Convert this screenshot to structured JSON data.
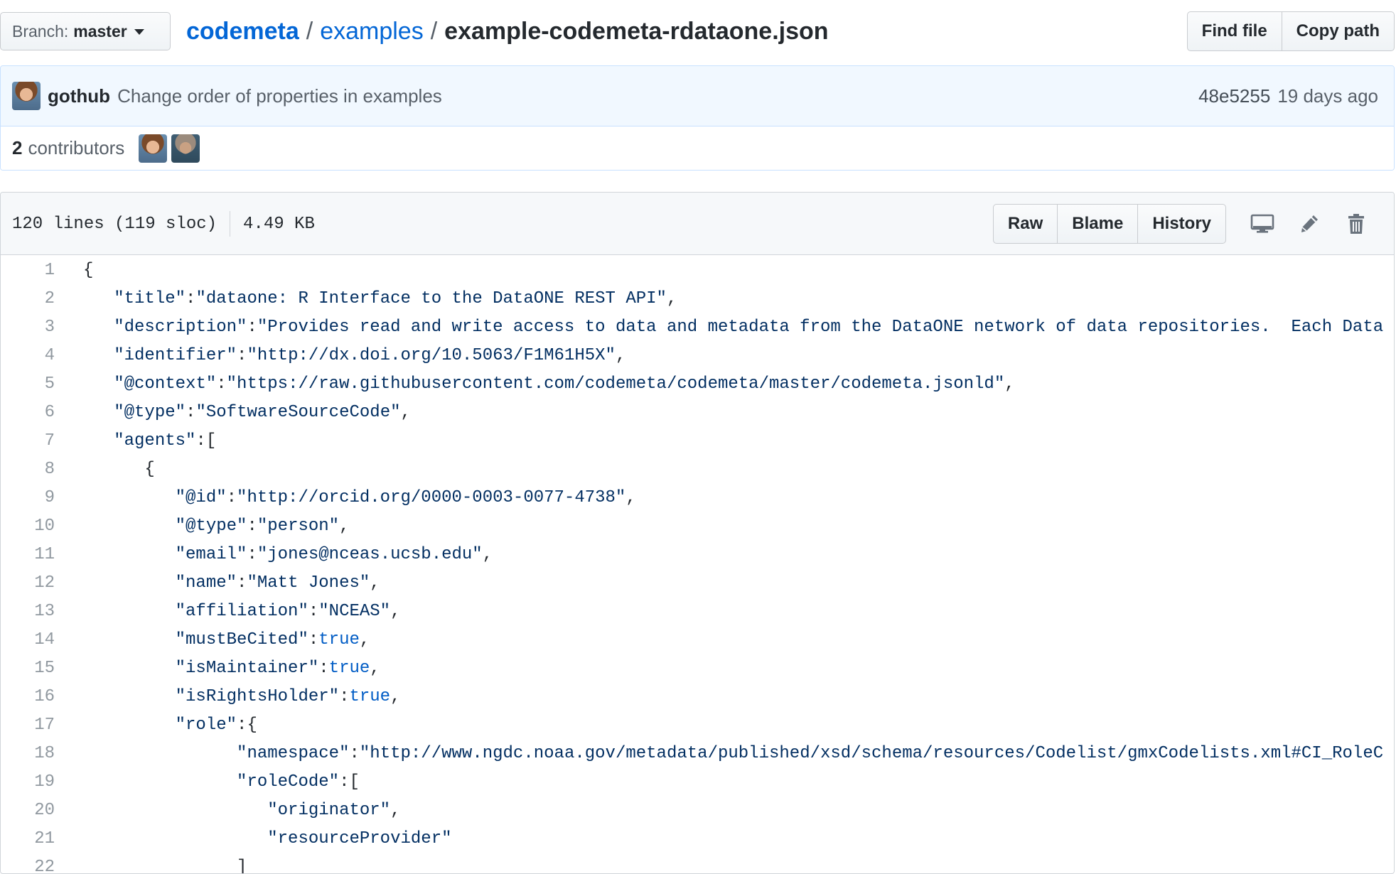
{
  "file_nav": {
    "branch_label": "Branch:",
    "branch_name": "master",
    "breadcrumb": {
      "repo": "codemeta",
      "dir": "examples",
      "file": "example-codemeta-rdataone.json",
      "separator": "/"
    },
    "find_file_label": "Find file",
    "copy_path_label": "Copy path"
  },
  "commit": {
    "author": "gothub",
    "message": "Change order of properties in examples",
    "sha": "48e5255",
    "age": "19 days ago"
  },
  "contributors": {
    "count": "2",
    "label": "contributors"
  },
  "file_header": {
    "lines": "120 lines (119 sloc)",
    "size": "4.49 KB",
    "raw_label": "Raw",
    "blame_label": "Blame",
    "history_label": "History",
    "icons": [
      "desktop-icon",
      "pencil-icon",
      "trash-icon"
    ]
  },
  "colors": {
    "link": "#0366d6",
    "string": "#032f62",
    "boolean": "#005cc5",
    "commit_bg": "#f1f8ff",
    "header_bg": "#f6f8fa"
  },
  "code_lines": [
    {
      "n": "1",
      "indent": "",
      "tokens": [
        [
          "p",
          "{"
        ]
      ]
    },
    {
      "n": "2",
      "indent": "   ",
      "tokens": [
        [
          "s",
          "\"title\""
        ],
        [
          "p",
          ":"
        ],
        [
          "s",
          "\"dataone: R Interface to the DataONE REST API\""
        ],
        [
          "p",
          ","
        ]
      ]
    },
    {
      "n": "3",
      "indent": "   ",
      "tokens": [
        [
          "s",
          "\"description\""
        ],
        [
          "p",
          ":"
        ],
        [
          "s",
          "\"Provides read and write access to data and metadata from the DataONE network of data repositories.  Each Data"
        ]
      ]
    },
    {
      "n": "4",
      "indent": "   ",
      "tokens": [
        [
          "s",
          "\"identifier\""
        ],
        [
          "p",
          ":"
        ],
        [
          "s",
          "\"http://dx.doi.org/10.5063/F1M61H5X\""
        ],
        [
          "p",
          ","
        ]
      ]
    },
    {
      "n": "5",
      "indent": "   ",
      "tokens": [
        [
          "s",
          "\"@context\""
        ],
        [
          "p",
          ":"
        ],
        [
          "s",
          "\"https://raw.githubusercontent.com/codemeta/codemeta/master/codemeta.jsonld\""
        ],
        [
          "p",
          ","
        ]
      ]
    },
    {
      "n": "6",
      "indent": "   ",
      "tokens": [
        [
          "s",
          "\"@type\""
        ],
        [
          "p",
          ":"
        ],
        [
          "s",
          "\"SoftwareSourceCode\""
        ],
        [
          "p",
          ","
        ]
      ]
    },
    {
      "n": "7",
      "indent": "   ",
      "tokens": [
        [
          "s",
          "\"agents\""
        ],
        [
          "p",
          ":["
        ]
      ]
    },
    {
      "n": "8",
      "indent": "      ",
      "tokens": [
        [
          "p",
          "{"
        ]
      ]
    },
    {
      "n": "9",
      "indent": "         ",
      "tokens": [
        [
          "s",
          "\"@id\""
        ],
        [
          "p",
          ":"
        ],
        [
          "s",
          "\"http://orcid.org/0000-0003-0077-4738\""
        ],
        [
          "p",
          ","
        ]
      ]
    },
    {
      "n": "10",
      "indent": "         ",
      "tokens": [
        [
          "s",
          "\"@type\""
        ],
        [
          "p",
          ":"
        ],
        [
          "s",
          "\"person\""
        ],
        [
          "p",
          ","
        ]
      ]
    },
    {
      "n": "11",
      "indent": "         ",
      "tokens": [
        [
          "s",
          "\"email\""
        ],
        [
          "p",
          ":"
        ],
        [
          "s",
          "\"jones@nceas.ucsb.edu\""
        ],
        [
          "p",
          ","
        ]
      ]
    },
    {
      "n": "12",
      "indent": "         ",
      "tokens": [
        [
          "s",
          "\"name\""
        ],
        [
          "p",
          ":"
        ],
        [
          "s",
          "\"Matt Jones\""
        ],
        [
          "p",
          ","
        ]
      ]
    },
    {
      "n": "13",
      "indent": "         ",
      "tokens": [
        [
          "s",
          "\"affiliation\""
        ],
        [
          "p",
          ":"
        ],
        [
          "s",
          "\"NCEAS\""
        ],
        [
          "p",
          ","
        ]
      ]
    },
    {
      "n": "14",
      "indent": "         ",
      "tokens": [
        [
          "s",
          "\"mustBeCited\""
        ],
        [
          "p",
          ":"
        ],
        [
          "b",
          "true"
        ],
        [
          "p",
          ","
        ]
      ]
    },
    {
      "n": "15",
      "indent": "         ",
      "tokens": [
        [
          "s",
          "\"isMaintainer\""
        ],
        [
          "p",
          ":"
        ],
        [
          "b",
          "true"
        ],
        [
          "p",
          ","
        ]
      ]
    },
    {
      "n": "16",
      "indent": "         ",
      "tokens": [
        [
          "s",
          "\"isRightsHolder\""
        ],
        [
          "p",
          ":"
        ],
        [
          "b",
          "true"
        ],
        [
          "p",
          ","
        ]
      ]
    },
    {
      "n": "17",
      "indent": "         ",
      "tokens": [
        [
          "s",
          "\"role\""
        ],
        [
          "p",
          ":{"
        ]
      ]
    },
    {
      "n": "18",
      "indent": "               ",
      "tokens": [
        [
          "s",
          "\"namespace\""
        ],
        [
          "p",
          ":"
        ],
        [
          "s",
          "\"http://www.ngdc.noaa.gov/metadata/published/xsd/schema/resources/Codelist/gmxCodelists.xml#CI_RoleC"
        ]
      ]
    },
    {
      "n": "19",
      "indent": "               ",
      "tokens": [
        [
          "s",
          "\"roleCode\""
        ],
        [
          "p",
          ":["
        ]
      ]
    },
    {
      "n": "20",
      "indent": "                  ",
      "tokens": [
        [
          "s",
          "\"originator\""
        ],
        [
          "p",
          ","
        ]
      ]
    },
    {
      "n": "21",
      "indent": "                  ",
      "tokens": [
        [
          "s",
          "\"resourceProvider\""
        ]
      ]
    },
    {
      "n": "22",
      "indent": "               ",
      "tokens": [
        [
          "p",
          "]"
        ]
      ]
    }
  ]
}
